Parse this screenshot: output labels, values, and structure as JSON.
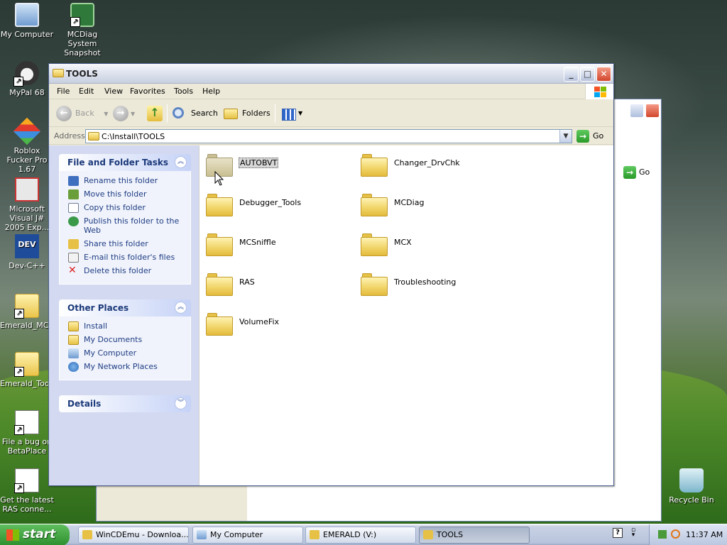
{
  "desktop": {
    "icons": [
      {
        "label": "My Computer",
        "icon": "my-computer-icon"
      },
      {
        "label": "MCDiag System Snapshot",
        "icon": "diag-app-icon"
      },
      {
        "label": "MyPal 68",
        "icon": "mypal-browser-icon"
      },
      {
        "label": "Roblox Fucker Pro 1.67",
        "icon": "roblox-icon"
      },
      {
        "label": "Microsoft Visual J# 2005 Exp...",
        "icon": "vj-sharp-icon"
      },
      {
        "label": "Dev-C++",
        "icon": "devcpp-icon"
      },
      {
        "label": "Emerald_MC...",
        "icon": "folder-shortcut-icon"
      },
      {
        "label": "Emerald_Too...",
        "icon": "folder-shortcut-icon"
      },
      {
        "label": "File a bug on BetaPlace",
        "icon": "document-shortcut-icon"
      },
      {
        "label": "Get the latest RAS conne...",
        "icon": "document-shortcut-icon"
      },
      {
        "label": "Recycle Bin",
        "icon": "recycle-bin-icon"
      }
    ],
    "dev_icon_text": "DEV"
  },
  "background_window": {
    "go_label": "Go"
  },
  "window": {
    "title": "TOOLS",
    "caption_minimize": "_",
    "caption_maximize": "□",
    "caption_close": "✕",
    "menu": [
      "File",
      "Edit",
      "View",
      "Favorites",
      "Tools",
      "Help"
    ],
    "toolbar": {
      "back": "Back",
      "search": "Search",
      "folders": "Folders"
    },
    "address": {
      "label": "Address",
      "value": "C:\\Install\\TOOLS",
      "go": "Go"
    },
    "task_pane": {
      "file_tasks": {
        "title": "File and Folder Tasks",
        "items": [
          "Rename this folder",
          "Move this folder",
          "Copy this folder",
          "Publish this folder to the Web",
          "Share this folder",
          "E-mail this folder's files",
          "Delete this folder"
        ]
      },
      "other_places": {
        "title": "Other Places",
        "items": [
          "Install",
          "My Documents",
          "My Computer",
          "My Network Places"
        ]
      },
      "details": {
        "title": "Details"
      }
    },
    "folders": [
      "AUTOBVT",
      "Changer_DrvChk",
      "Debugger_Tools",
      "MCDiag",
      "MCSniffle",
      "MCX",
      "RAS",
      "Troubleshooting",
      "VolumeFix"
    ],
    "selected_folder": "AUTOBVT"
  },
  "taskbar": {
    "start": "start",
    "buttons": [
      {
        "label": "WinCDEmu - Downloa...",
        "active": false
      },
      {
        "label": "My Computer",
        "active": false
      },
      {
        "label": "EMERALD (V:)",
        "active": false
      },
      {
        "label": "TOOLS",
        "active": true
      }
    ],
    "clock": "11:37 AM"
  },
  "colors": {
    "xp_blue_link": "#1e3c84",
    "selection_gray": "#d8d8d8",
    "start_green": "#2e8f2e",
    "close_red": "#d2462d"
  }
}
